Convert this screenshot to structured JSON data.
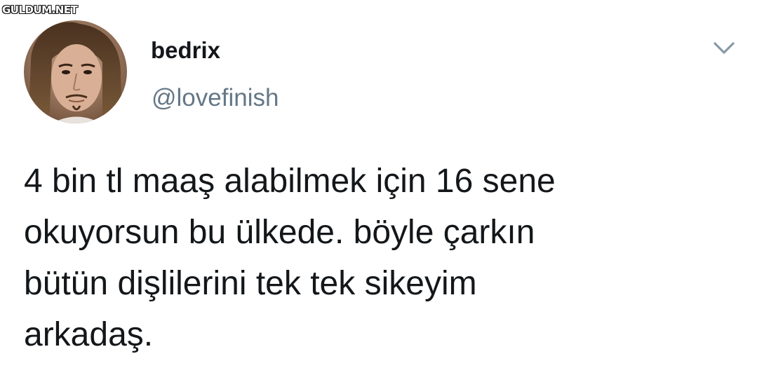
{
  "watermark": {
    "text": "GULDUM.NET"
  },
  "tweet": {
    "author": {
      "display_name": "bedrix",
      "handle": "@lovefinish",
      "avatar_icon": "profile-photo"
    },
    "menu_icon": "chevron-down-icon",
    "text": "4 bin tl maaş alabilmek için 16 sene\nokuyorsun bu ülkede. böyle çarkın\nbütün dişlilerini tek tek sikeyim\narkadaş."
  },
  "colors": {
    "background": "#ffffff",
    "text_primary": "#14171a",
    "text_secondary": "#657786",
    "caret": "#8899a6"
  }
}
